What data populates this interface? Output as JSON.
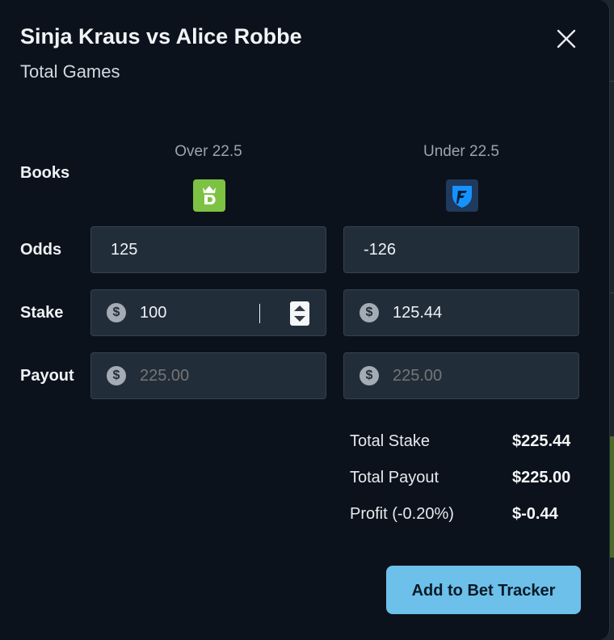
{
  "modal": {
    "title": "Sinja Kraus vs Alice Robbe",
    "subtitle": "Total Games"
  },
  "columns": [
    {
      "heading": "Over 22.5",
      "book_icon": "draftkings-logo-icon",
      "book_color": "#7dc242"
    },
    {
      "heading": "Under 22.5",
      "book_icon": "fanduel-logo-icon",
      "book_color": "#1f3a5c"
    }
  ],
  "rows": {
    "books_label": "Books",
    "odds_label": "Odds",
    "stake_label": "Stake",
    "payout_label": "Payout"
  },
  "inputs": {
    "odds_over": "125",
    "odds_under": "-126",
    "stake_over": "100",
    "stake_under": "125.44",
    "payout_over_placeholder": "225.00",
    "payout_under_placeholder": "225.00"
  },
  "currency_symbol": "$",
  "summary": {
    "total_stake_label": "Total Stake",
    "total_stake_value": "$225.44",
    "total_payout_label": "Total Payout",
    "total_payout_value": "$225.00",
    "profit_label": "Profit (-0.20%)",
    "profit_value": "$-0.44"
  },
  "actions": {
    "add_label": "Add to Bet Tracker"
  },
  "colors": {
    "accent": "#6cc0ea",
    "modal_bg": "#0b121b",
    "field_bg": "#222d3a"
  }
}
